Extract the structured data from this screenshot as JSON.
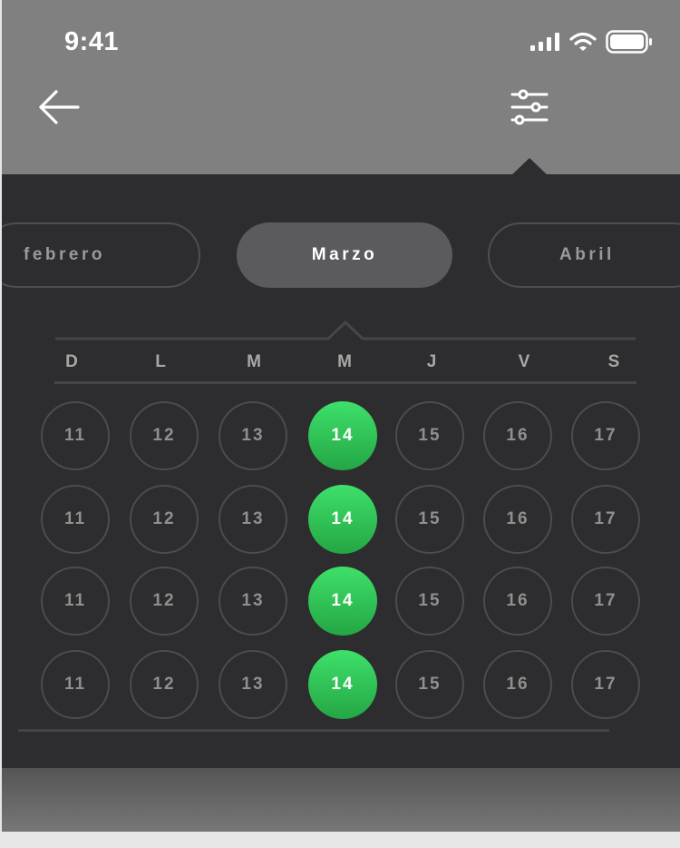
{
  "status_bar": {
    "time": "9:41",
    "icons": [
      "cellular-signal-icon",
      "wifi-icon",
      "battery-icon"
    ]
  },
  "header": {
    "back_icon": "arrow-left-icon",
    "filter_icon": "sliders-icon"
  },
  "months": {
    "previous": "febrero",
    "current": "Marzo",
    "next": "Abril"
  },
  "weekdays": [
    "D",
    "L",
    "M",
    "M",
    "J",
    "V",
    "S"
  ],
  "weeks": [
    [
      "11",
      "12",
      "13",
      "14",
      "15",
      "16",
      "17"
    ],
    [
      "11",
      "12",
      "13",
      "14",
      "15",
      "16",
      "17"
    ],
    [
      "11",
      "12",
      "13",
      "14",
      "15",
      "16",
      "17"
    ],
    [
      "11",
      "12",
      "13",
      "14",
      "15",
      "16",
      "17"
    ]
  ],
  "selected_column": 3,
  "colors": {
    "panel_background": "#2d2d2f",
    "selected_day_gradient": [
      "#3ee06a",
      "#24a644"
    ],
    "active_month_pill": "#5b5b5d"
  }
}
